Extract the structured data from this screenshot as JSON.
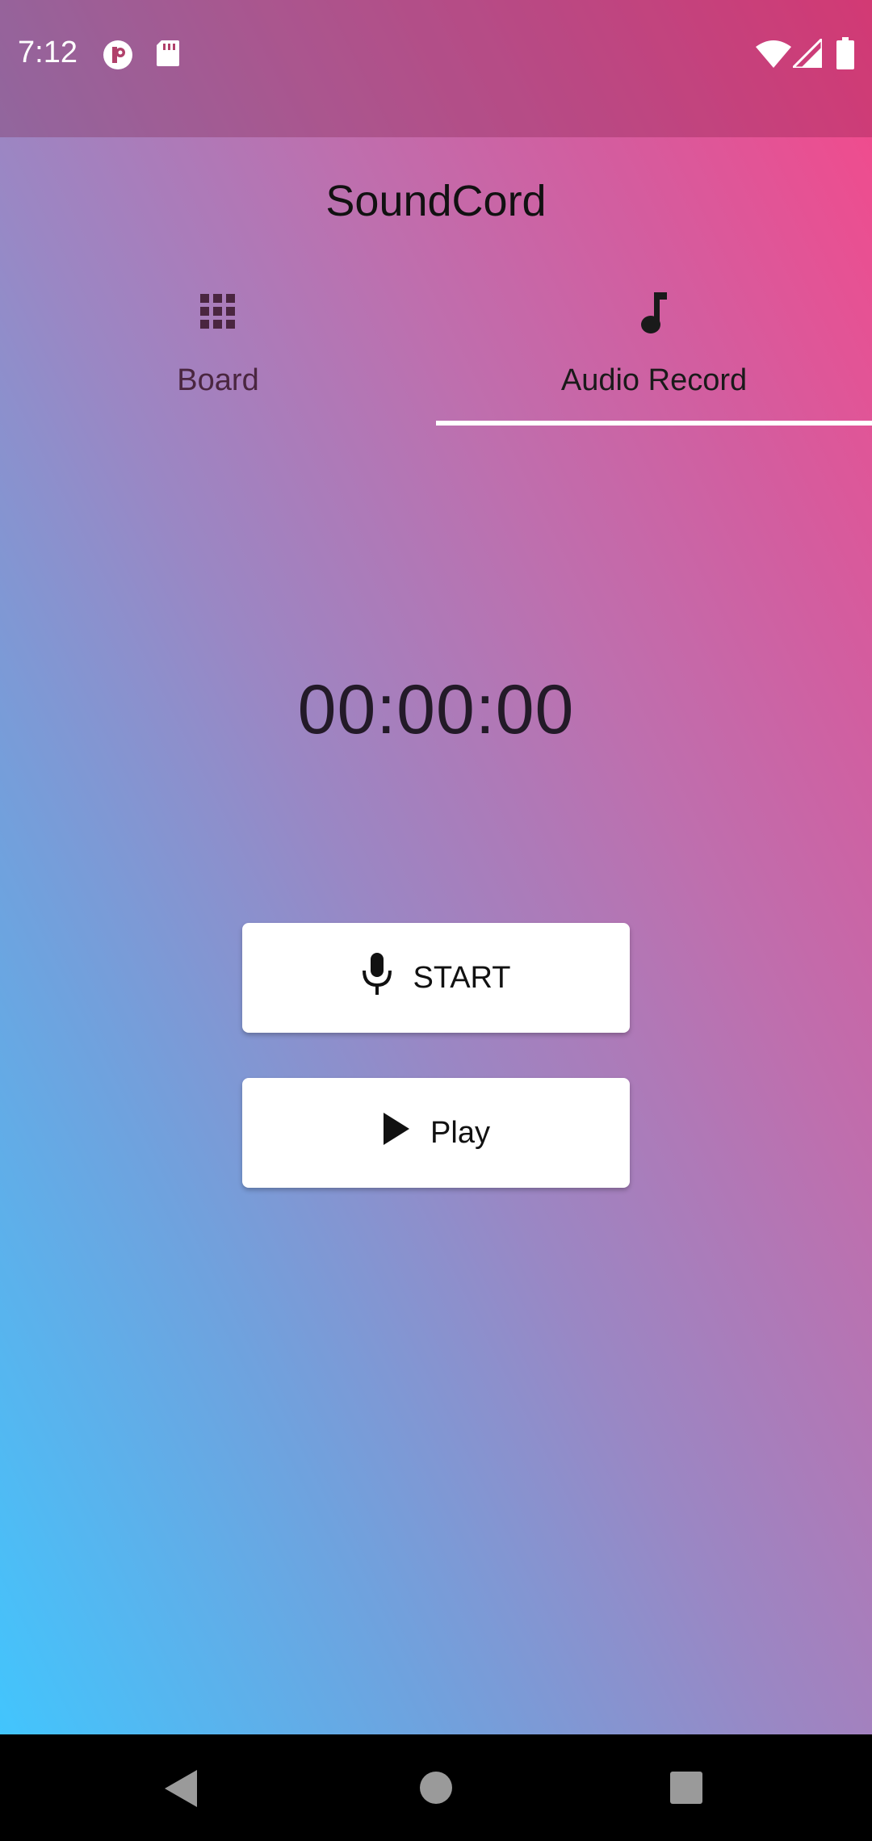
{
  "status_bar": {
    "time": "7:12"
  },
  "app": {
    "title": "SoundCord"
  },
  "tabs": [
    {
      "label": "Board",
      "icon": "grid-icon",
      "selected": false
    },
    {
      "label": "Audio Record",
      "icon": "music-note-icon",
      "selected": true
    }
  ],
  "recorder": {
    "timer": "00:00:00",
    "start_label": "START",
    "play_label": "Play"
  },
  "colors": {
    "gradient_top_right": "#f6488a",
    "gradient_bottom_left": "#42c5fd",
    "button_bg": "#ffffff",
    "tab_indicator": "#ffffff"
  }
}
